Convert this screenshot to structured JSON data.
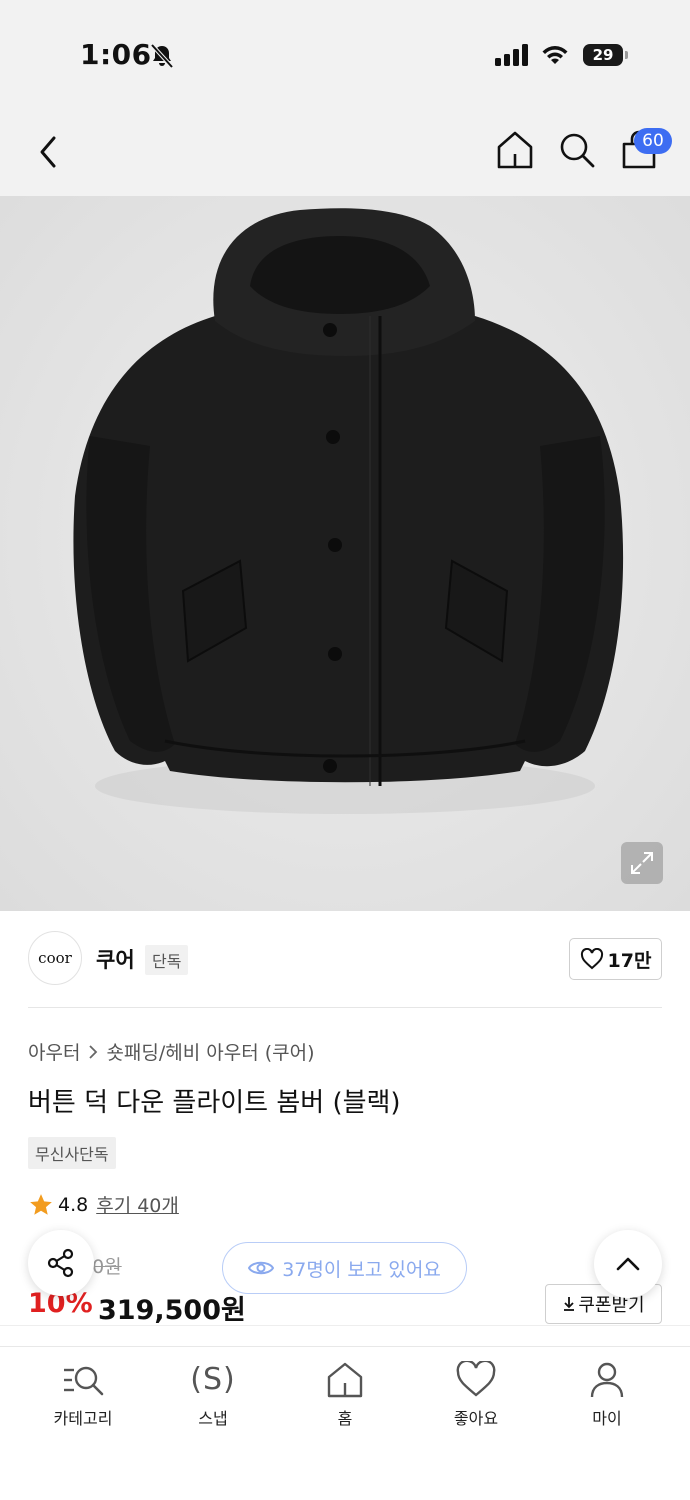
{
  "status_bar": {
    "time": "1:06",
    "battery": "29"
  },
  "header": {
    "cart_count": "60"
  },
  "brand": {
    "logo_text": "coor",
    "name": "쿠어",
    "badge": "단독",
    "likes": "17만"
  },
  "breadcrumb": {
    "category": "아우터",
    "subcategory": "숏패딩/헤비 아우터 (쿠어)"
  },
  "product": {
    "title": "버튼 덕 다운 플라이트 봄버 (블랙)",
    "exclusive_badge": "무신사단독",
    "rating": "4.8",
    "reviews": "후기 40개",
    "original_price": "00원",
    "discount": "10%",
    "price": "319,500원",
    "coupon_label": "쿠폰받기"
  },
  "floating": {
    "viewers_text": "37명이 보고 있어요"
  },
  "tabbar": {
    "items": [
      {
        "label": "카테고리",
        "icon": "category-search-icon"
      },
      {
        "label": "스냅",
        "icon": "snap-icon",
        "glyph": "(S)"
      },
      {
        "label": "홈",
        "icon": "home-icon"
      },
      {
        "label": "좋아요",
        "icon": "heart-icon"
      },
      {
        "label": "마이",
        "icon": "person-icon"
      }
    ]
  },
  "colors": {
    "accent_blue": "#3d6df2",
    "discount_red": "#e02020",
    "viewers_blue": "#8aa9ee"
  }
}
